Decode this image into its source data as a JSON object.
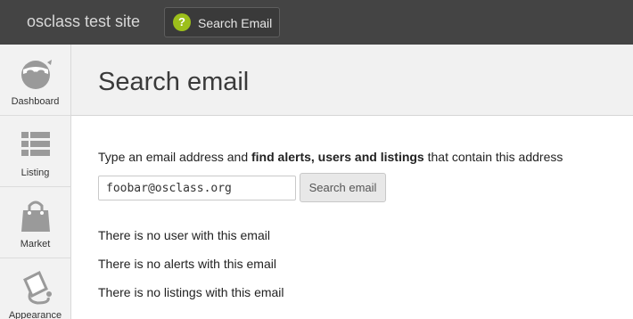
{
  "topbar": {
    "site_title": "osclass test site",
    "help_button": {
      "icon": "question-icon",
      "glyph": "?",
      "label": "Search Email"
    }
  },
  "sidebar": {
    "items": [
      {
        "icon": "dashboard-icon",
        "label": "Dashboard"
      },
      {
        "icon": "listing-icon",
        "label": "Listing"
      },
      {
        "icon": "market-icon",
        "label": "Market"
      },
      {
        "icon": "appearance-icon",
        "label": "Appearance"
      }
    ]
  },
  "header": {
    "title": "Search email"
  },
  "main": {
    "intro_prefix": "Type an email address and ",
    "intro_bold": "find alerts, users and listings",
    "intro_suffix": " that contain this address",
    "email_value": "foobar@osclass.org",
    "search_button": "Search email",
    "results": [
      "There is no user with this email",
      "There is no alerts with this email",
      "There is no listings with this email"
    ]
  },
  "colors": {
    "topbar": "#444444",
    "accent_green": "#9cbf1b",
    "sidebar_bg": "#f2f2f2",
    "header_bg": "#f1f1f1"
  }
}
